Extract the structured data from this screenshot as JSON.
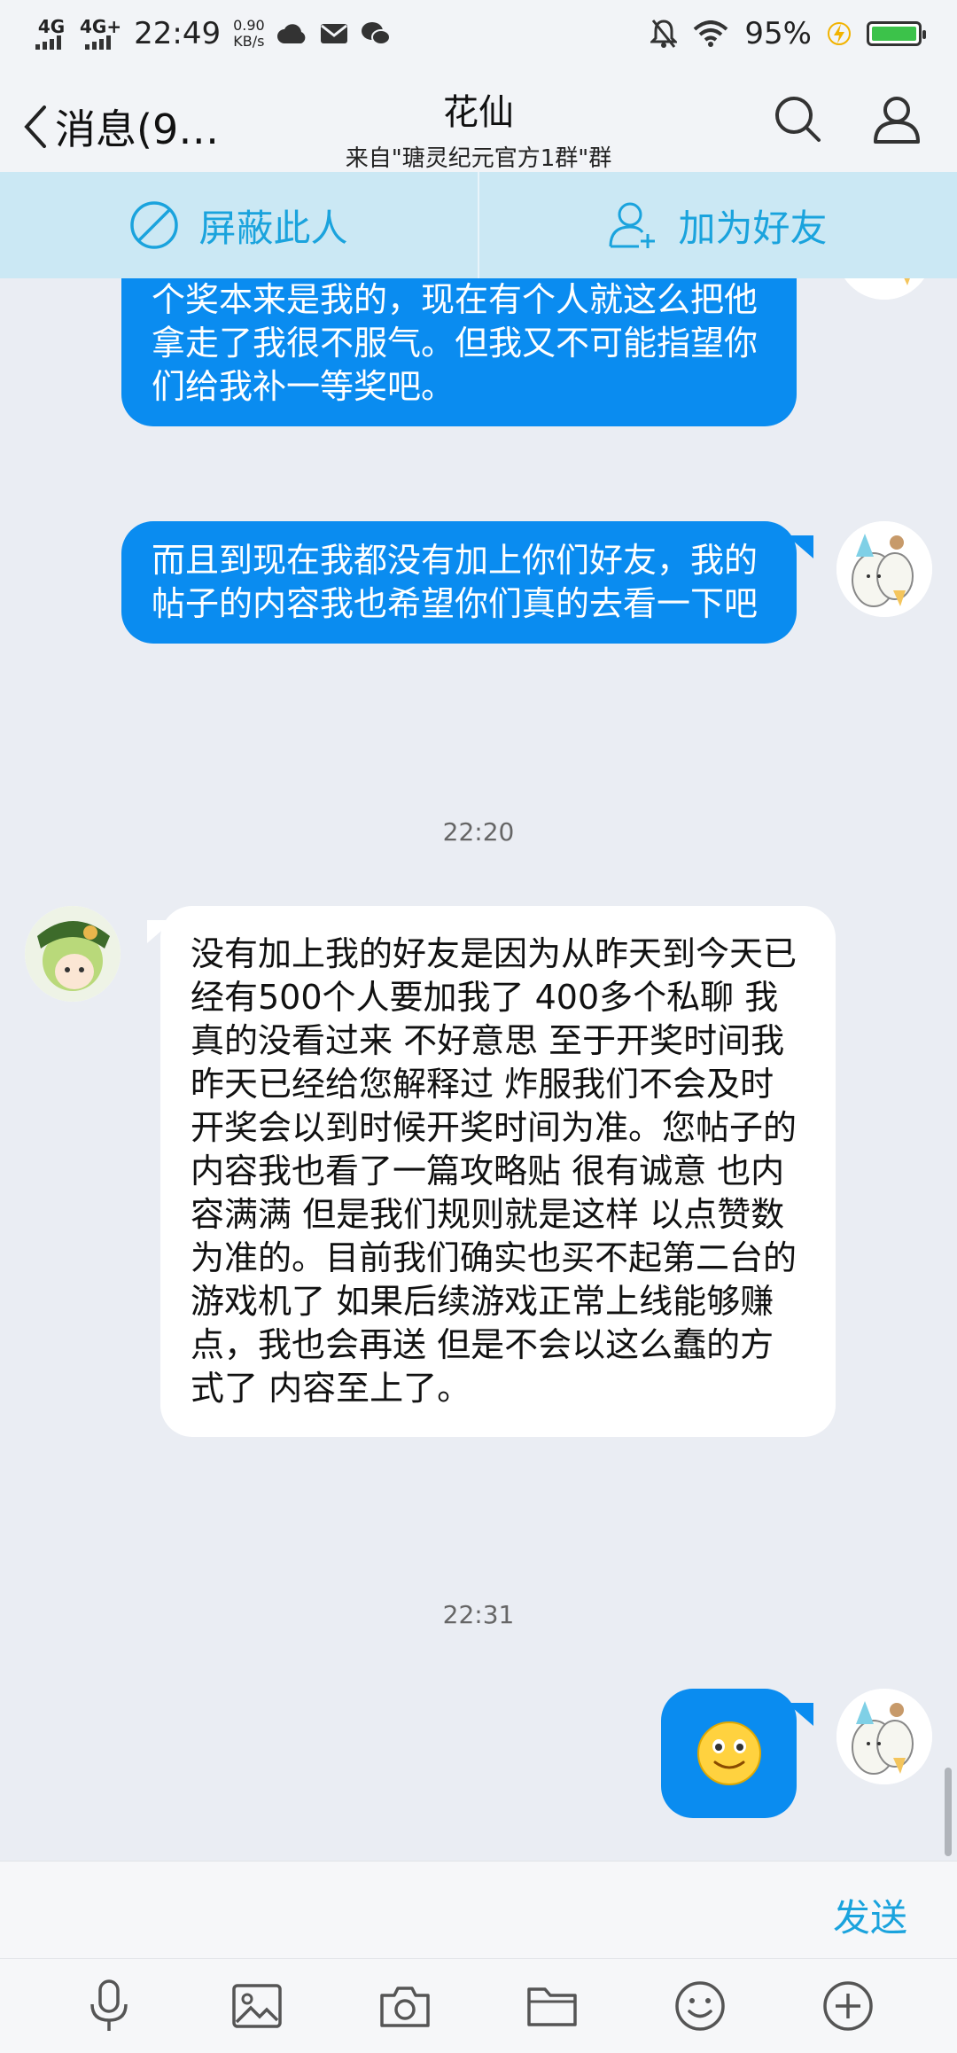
{
  "status": {
    "signal1": "4G",
    "signal2": "4G+",
    "time": "22:49",
    "speed_value": "0.90",
    "speed_unit": "KB/s",
    "battery": "95%"
  },
  "nav": {
    "back_label": "消息(9…",
    "title": "花仙",
    "subtitle": "来自\"瑭灵纪元官方1群\"群"
  },
  "actions": {
    "block_label": "屏蔽此人",
    "add_friend_label": "加为好友"
  },
  "messages": [
    {
      "text": "个奖本来是我的，现在有个人就这么把他拿走了我很不服气。但我又不可能指望你们给我补一等奖吧。"
    },
    {
      "text": "而且到现在我都没有加上你们好友，我的帖子的内容我也希望你们真的去看一下吧"
    },
    {
      "time": "22:20"
    },
    {
      "text": "没有加上我的好友是因为从昨天到今天已经有500个人要加我了  400多个私聊  我真的没看过来 不好意思 至于开奖时间我昨天已经给您解释过 炸服我们不会及时开奖会以到时候开奖时间为准。您帖子的内容我也看了一篇攻略贴 很有诚意  也内容满满 但是我们规则就是这样 以点赞数为准的。目前我们确实也买不起第二台的游戏机了   如果后续游戏正常上线能够赚点，我也会再送 但是不会以这么蠢的方式了   内容至上了。"
    },
    {
      "time": "22:31"
    }
  ],
  "input": {
    "send_label": "发送"
  },
  "colors": {
    "accent": "#1aa3dd",
    "bubble_out": "#0a8cf0",
    "action_bar": "#cbe8f4"
  }
}
